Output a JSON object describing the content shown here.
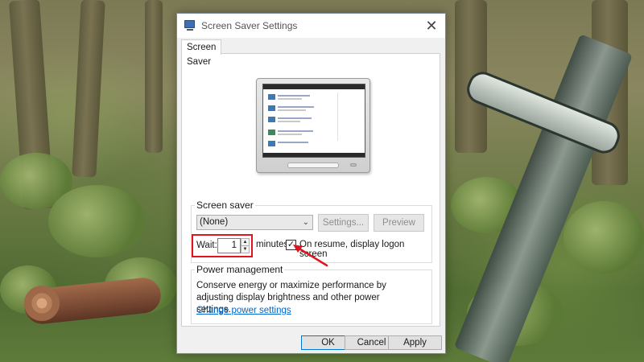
{
  "window": {
    "title": "Screen Saver Settings",
    "close_glyph": "✕"
  },
  "tabs": [
    {
      "label": "Screen Saver",
      "active": true
    }
  ],
  "screen_saver": {
    "group_label": "Screen saver",
    "selected": "(None)",
    "settings_label": "Settings...",
    "preview_label": "Preview",
    "wait_label": "Wait:",
    "wait_value": "1",
    "minutes_label": "minutes",
    "resume_checked": true,
    "resume_label": "On resume, display logon screen"
  },
  "power": {
    "group_label": "Power management",
    "description": "Conserve energy or maximize performance by adjusting display brightness and other power settings.",
    "link": "Change power settings"
  },
  "footer": {
    "ok": "OK",
    "cancel": "Cancel",
    "apply": "Apply"
  },
  "colors": {
    "highlight": "#e0141e",
    "link": "#0066cc",
    "accent": "#0078d7"
  },
  "icons": {
    "app": "monitor-icon",
    "close": "close-icon",
    "dropdown": "chevron-down-icon",
    "spin_up": "spin-up-icon",
    "spin_down": "spin-down-icon",
    "check": "checkmark-icon"
  }
}
